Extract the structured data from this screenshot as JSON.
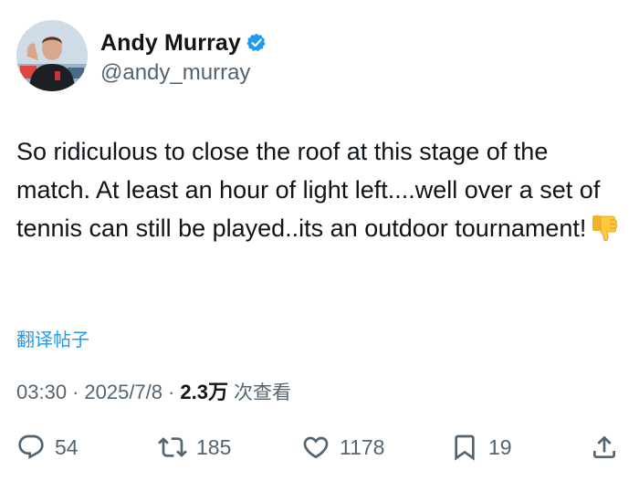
{
  "tweet": {
    "author": {
      "display_name": "Andy Murray",
      "handle": "@andy_murray",
      "verified": true
    },
    "text": "So ridiculous to close the roof at this stage of the match. At least an hour of light left....well over a set of tennis can still be played..its an outdoor tournament!",
    "emoji": "thumbs-down",
    "translate_label": "翻译帖子",
    "time": "03:30",
    "separator": "·",
    "date": "2025/7/8",
    "views_count": "2.3万",
    "views_label": "次查看"
  },
  "actions": {
    "replies": "54",
    "reposts": "185",
    "likes": "1178",
    "bookmarks": "19"
  },
  "icons": [
    "verified-badge-icon",
    "reply-icon",
    "repost-icon",
    "like-icon",
    "bookmark-icon",
    "share-icon",
    "thumbs-down-emoji"
  ],
  "colors": {
    "text": "#0f1419",
    "secondary": "#536471",
    "accent": "#1d9bf0"
  }
}
